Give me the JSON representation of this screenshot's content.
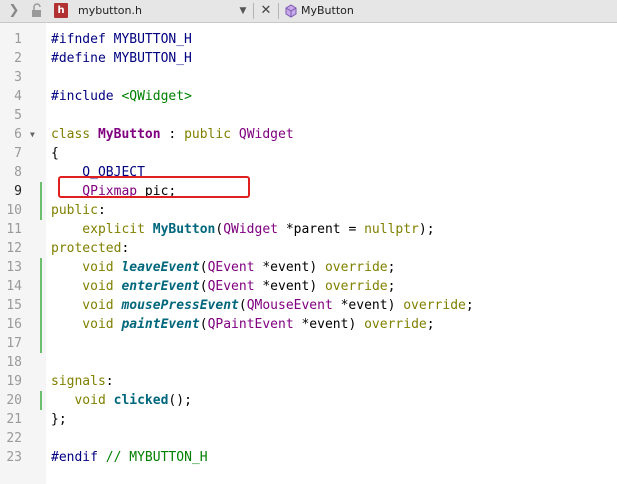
{
  "tabbar": {
    "file_name": "mybutton.h",
    "file_icon_letter": "h",
    "symbol_name": "MyButton",
    "nav_icon": "chevron-right-icon",
    "lock_icon": "lock-icon",
    "close_icon": "close-icon",
    "class_icon": "class-icon"
  },
  "editor": {
    "current_line": 9,
    "lines": [
      {
        "n": "1",
        "tokens": [
          {
            "c": "pp",
            "t": "#ifndef MYBUTTON_H"
          }
        ]
      },
      {
        "n": "2",
        "tokens": [
          {
            "c": "pp",
            "t": "#define MYBUTTON_H"
          }
        ]
      },
      {
        "n": "3",
        "tokens": []
      },
      {
        "n": "4",
        "tokens": [
          {
            "c": "pp",
            "t": "#include "
          },
          {
            "c": "inc",
            "t": "<QWidget>"
          }
        ]
      },
      {
        "n": "5",
        "tokens": []
      },
      {
        "n": "6",
        "tokens": [
          {
            "c": "kw",
            "t": "class "
          },
          {
            "c": "cls",
            "t": "MyButton"
          },
          {
            "c": "plain",
            "t": " : "
          },
          {
            "c": "kw",
            "t": "public "
          },
          {
            "c": "type",
            "t": "QWidget"
          }
        ]
      },
      {
        "n": "7",
        "tokens": [
          {
            "c": "plain",
            "t": "{"
          }
        ]
      },
      {
        "n": "8",
        "tokens": [
          {
            "c": "macro",
            "t": "    Q_OBJECT"
          }
        ]
      },
      {
        "n": "9",
        "tokens": [
          {
            "c": "type",
            "t": "    QPixmap "
          },
          {
            "c": "var",
            "t": "pic;"
          }
        ]
      },
      {
        "n": "10",
        "tokens": [
          {
            "c": "kw",
            "t": "public"
          },
          {
            "c": "plain",
            "t": ":"
          }
        ]
      },
      {
        "n": "11",
        "tokens": [
          {
            "c": "kw",
            "t": "    explicit "
          },
          {
            "c": "fn",
            "t": "MyButton"
          },
          {
            "c": "plain",
            "t": "("
          },
          {
            "c": "type",
            "t": "QWidget"
          },
          {
            "c": "plain",
            "t": " *parent = "
          },
          {
            "c": "kw",
            "t": "nullptr"
          },
          {
            "c": "plain",
            "t": ");"
          }
        ]
      },
      {
        "n": "12",
        "tokens": [
          {
            "c": "kw",
            "t": "protected"
          },
          {
            "c": "plain",
            "t": ":"
          }
        ]
      },
      {
        "n": "13",
        "tokens": [
          {
            "c": "kw",
            "t": "    void "
          },
          {
            "c": "vfn",
            "t": "leaveEvent"
          },
          {
            "c": "plain",
            "t": "("
          },
          {
            "c": "type",
            "t": "QEvent"
          },
          {
            "c": "plain",
            "t": " *event) "
          },
          {
            "c": "kw",
            "t": "override"
          },
          {
            "c": "plain",
            "t": ";"
          }
        ]
      },
      {
        "n": "14",
        "tokens": [
          {
            "c": "kw",
            "t": "    void "
          },
          {
            "c": "vfn",
            "t": "enterEvent"
          },
          {
            "c": "plain",
            "t": "("
          },
          {
            "c": "type",
            "t": "QEvent"
          },
          {
            "c": "plain",
            "t": " *event) "
          },
          {
            "c": "kw",
            "t": "override"
          },
          {
            "c": "plain",
            "t": ";"
          }
        ]
      },
      {
        "n": "15",
        "tokens": [
          {
            "c": "kw",
            "t": "    void "
          },
          {
            "c": "vfn",
            "t": "mousePressEvent"
          },
          {
            "c": "plain",
            "t": "("
          },
          {
            "c": "type",
            "t": "QMouseEvent"
          },
          {
            "c": "plain",
            "t": " *event) "
          },
          {
            "c": "kw",
            "t": "override"
          },
          {
            "c": "plain",
            "t": ";"
          }
        ]
      },
      {
        "n": "16",
        "tokens": [
          {
            "c": "kw",
            "t": "    void "
          },
          {
            "c": "vfn",
            "t": "paintEvent"
          },
          {
            "c": "plain",
            "t": "("
          },
          {
            "c": "type",
            "t": "QPaintEvent"
          },
          {
            "c": "plain",
            "t": " *event) "
          },
          {
            "c": "kw",
            "t": "override"
          },
          {
            "c": "plain",
            "t": ";"
          }
        ]
      },
      {
        "n": "17",
        "tokens": []
      },
      {
        "n": "18",
        "tokens": []
      },
      {
        "n": "19",
        "tokens": [
          {
            "c": "kw",
            "t": "signals"
          },
          {
            "c": "plain",
            "t": ":"
          }
        ]
      },
      {
        "n": "20",
        "tokens": [
          {
            "c": "kw",
            "t": "   void "
          },
          {
            "c": "fn",
            "t": "clicked"
          },
          {
            "c": "plain",
            "t": "();"
          }
        ]
      },
      {
        "n": "21",
        "tokens": [
          {
            "c": "plain",
            "t": "};"
          }
        ]
      },
      {
        "n": "22",
        "tokens": []
      },
      {
        "n": "23",
        "tokens": [
          {
            "c": "pp",
            "t": "#endif "
          },
          {
            "c": "cmt",
            "t": "// MYBUTTON_H"
          }
        ]
      }
    ]
  }
}
